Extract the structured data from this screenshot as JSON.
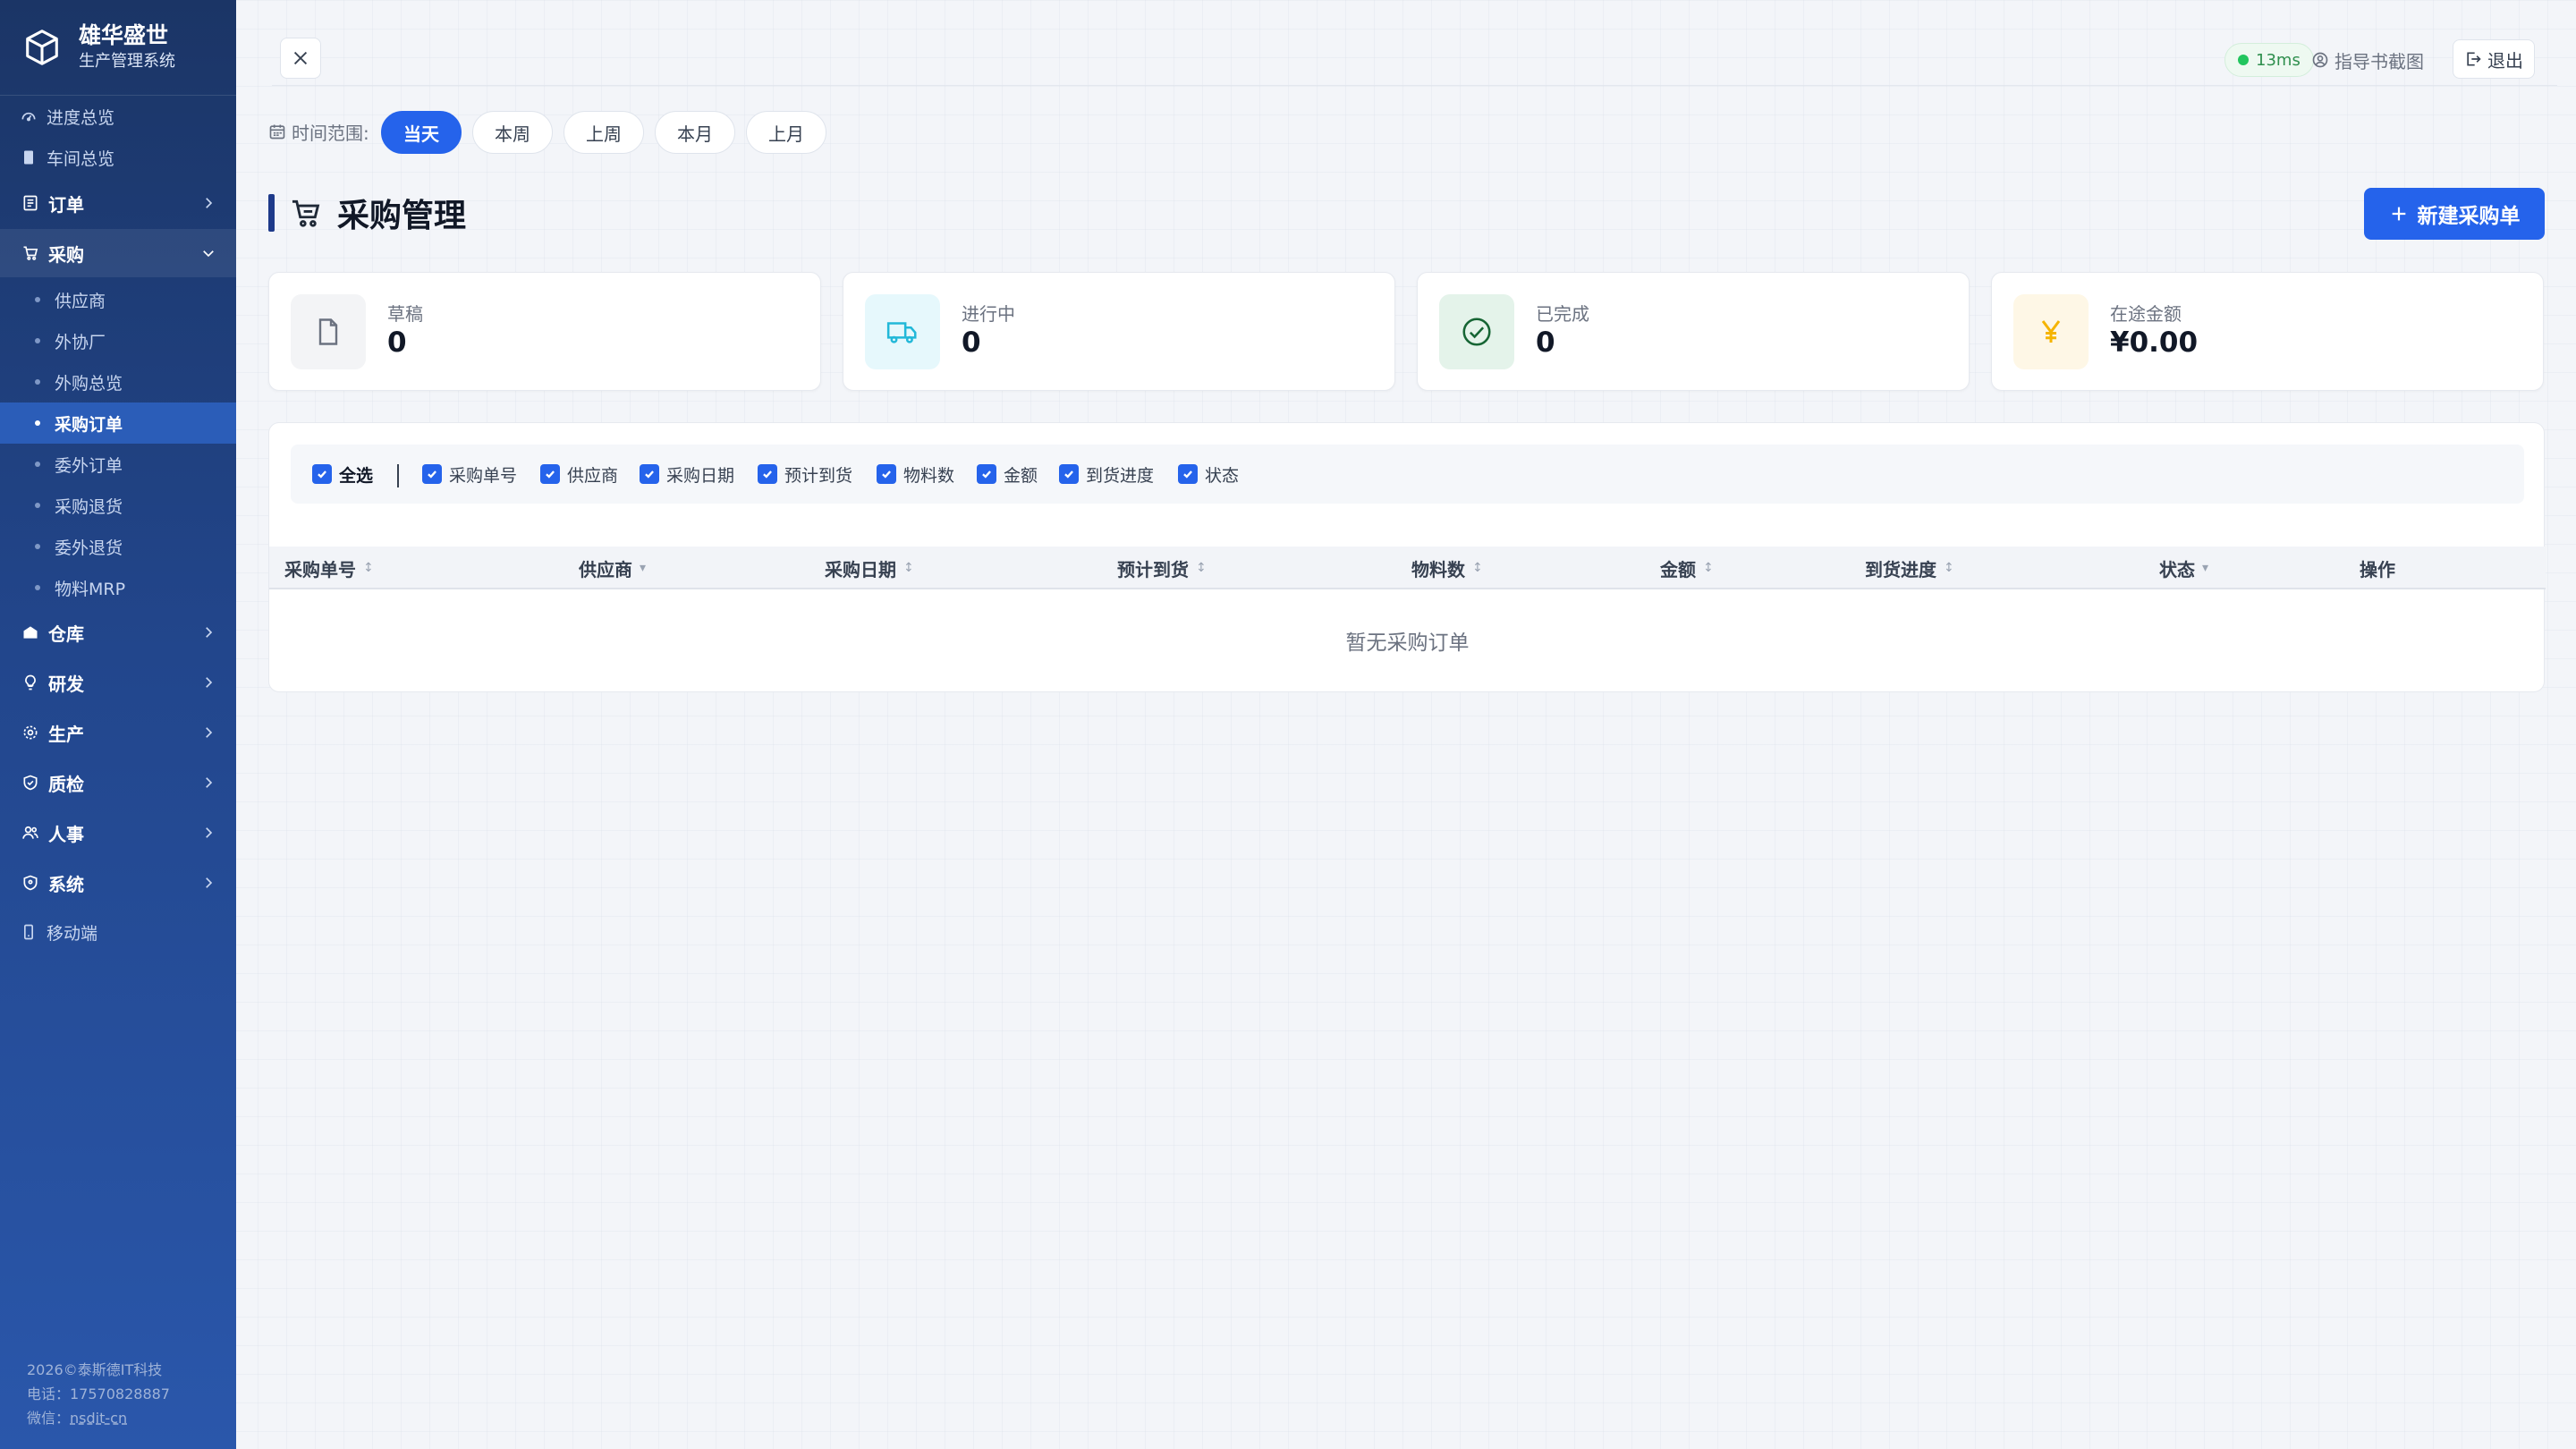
{
  "brand": {
    "title": "雄华盛世",
    "subtitle": "生产管理系统"
  },
  "sidebar": {
    "top_links": [
      {
        "label": "进度总览",
        "icon": "dashboard-icon"
      },
      {
        "label": "车间总览",
        "icon": "document-icon"
      }
    ],
    "sections": [
      {
        "label": "订单",
        "icon": "order-list-icon",
        "expanded": false
      },
      {
        "label": "采购",
        "icon": "cart-icon",
        "expanded": true
      },
      {
        "label": "仓库",
        "icon": "warehouse-icon",
        "expanded": false
      },
      {
        "label": "研发",
        "icon": "lightbulb-icon",
        "expanded": false
      },
      {
        "label": "生产",
        "icon": "gear-icon",
        "expanded": false
      },
      {
        "label": "质检",
        "icon": "shield-check-icon",
        "expanded": false
      },
      {
        "label": "人事",
        "icon": "users-icon",
        "expanded": false
      },
      {
        "label": "系统",
        "icon": "shield-icon",
        "expanded": false
      }
    ],
    "purchase_items": [
      {
        "label": "供应商",
        "active": false
      },
      {
        "label": "外协厂",
        "active": false
      },
      {
        "label": "外购总览",
        "active": false
      },
      {
        "label": "采购订单",
        "active": true
      },
      {
        "label": "委外订单",
        "active": false
      },
      {
        "label": "采购退货",
        "active": false
      },
      {
        "label": "委外退货",
        "active": false
      },
      {
        "label": "物料MRP",
        "active": false
      }
    ],
    "mobile_link": {
      "label": "移动端",
      "icon": "mobile-icon"
    },
    "footer": {
      "copyright": "2026©泰斯德IT科技",
      "phone": "电话：17570828887",
      "wechat_label": "微信：",
      "wechat_id": "nsdit-cn"
    }
  },
  "topbar": {
    "latency": "13ms",
    "guide_label": "指导书截图",
    "logout_label": "退出"
  },
  "time_range": {
    "label": "时间范围:",
    "options": [
      "当天",
      "本周",
      "上周",
      "本月",
      "上月"
    ],
    "selected": "当天"
  },
  "page": {
    "title": "采购管理",
    "new_button": "新建采购单"
  },
  "stats": [
    {
      "label": "草稿",
      "value": "0",
      "icon": "file-icon"
    },
    {
      "label": "进行中",
      "value": "0",
      "icon": "truck-icon"
    },
    {
      "label": "已完成",
      "value": "0",
      "icon": "check-circle-icon"
    },
    {
      "label": "在途金额",
      "value": "¥0.00",
      "icon": "yen-icon"
    }
  ],
  "column_toggles": {
    "select_all": "全选",
    "columns": [
      "采购单号",
      "供应商",
      "采购日期",
      "预计到货",
      "物料数",
      "金额",
      "到货进度",
      "状态"
    ]
  },
  "table": {
    "headers": [
      {
        "label": "采购单号",
        "sort": "↕"
      },
      {
        "label": "供应商",
        "sort": "▾"
      },
      {
        "label": "采购日期",
        "sort": "↕"
      },
      {
        "label": "预计到货",
        "sort": "↕"
      },
      {
        "label": "物料数",
        "sort": "↕"
      },
      {
        "label": "金额",
        "sort": "↕"
      },
      {
        "label": "到货进度",
        "sort": "↕"
      },
      {
        "label": "状态",
        "sort": "▾"
      },
      {
        "label": "操作",
        "sort": ""
      }
    ],
    "empty_text": "暂无采购订单"
  },
  "colors": {
    "primary": "#2563eb",
    "sidebar_top": "#1b3566",
    "sidebar_bottom": "#2a57ab",
    "success": "#22c55e"
  }
}
